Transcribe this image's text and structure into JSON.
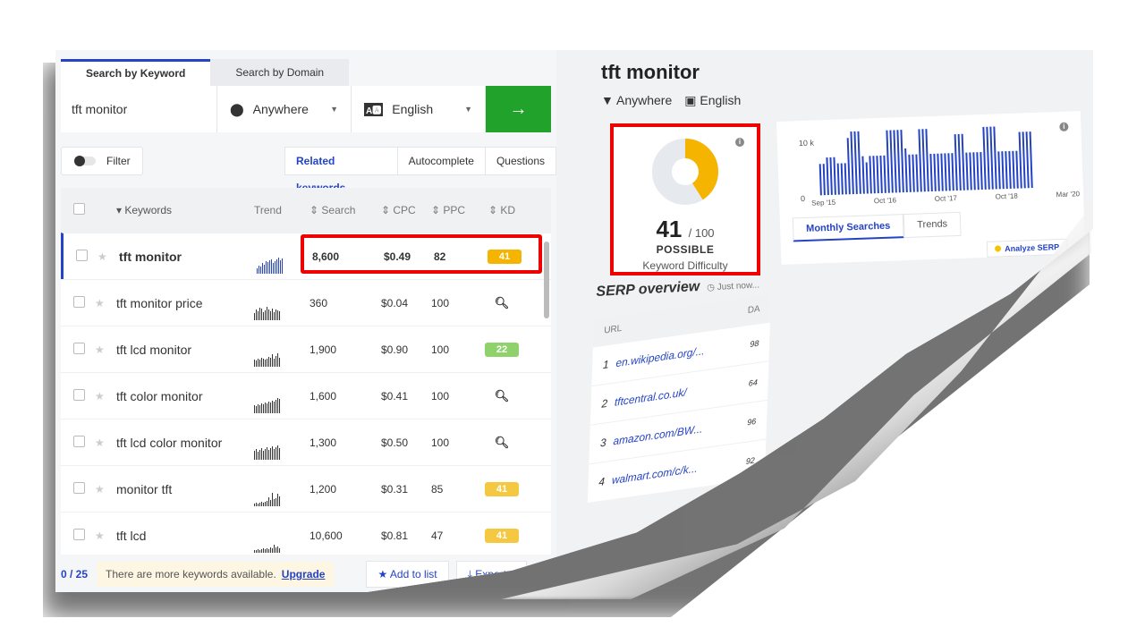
{
  "tabs": [
    "Search by Keyword",
    "Search by Domain"
  ],
  "search": {
    "query": "tft monitor",
    "location": "Anywhere",
    "language": "English",
    "go_icon": "arrow-right-icon"
  },
  "filter_label": "Filter",
  "subtabs": [
    "Related keywords",
    "Autocomplete",
    "Questions"
  ],
  "table": {
    "headers": {
      "keywords": "Keywords",
      "trend": "Trend",
      "search": "Search",
      "cpc": "CPC",
      "ppc": "PPC",
      "kd": "KD"
    },
    "rows": [
      {
        "keyword": "tft monitor",
        "search": "8,600",
        "cpc": "$0.49",
        "ppc": "82",
        "kd": "41",
        "kd_color": "#f5b400",
        "trend": [
          6,
          9,
          8,
          12,
          10,
          14,
          13,
          15,
          16,
          12,
          14,
          16,
          18,
          15,
          17
        ]
      },
      {
        "keyword": "tft monitor price",
        "search": "360",
        "cpc": "$0.04",
        "ppc": "100",
        "kd": "",
        "kd_icon": "search-icon",
        "trend": [
          8,
          12,
          10,
          14,
          13,
          9,
          11,
          15,
          12,
          10,
          13,
          9,
          12,
          11,
          10
        ]
      },
      {
        "keyword": "tft lcd monitor",
        "search": "1,900",
        "cpc": "$0.90",
        "ppc": "100",
        "kd": "22",
        "kd_color": "#8fd16a",
        "trend": [
          8,
          7,
          9,
          8,
          10,
          9,
          8,
          9,
          11,
          10,
          14,
          9,
          12,
          15,
          10
        ]
      },
      {
        "keyword": "tft color monitor",
        "search": "1,600",
        "cpc": "$0.41",
        "ppc": "100",
        "kd": "",
        "kd_icon": "search-icon",
        "trend": [
          9,
          8,
          10,
          9,
          11,
          10,
          12,
          11,
          13,
          12,
          14,
          13,
          15,
          17,
          16
        ]
      },
      {
        "keyword": "tft lcd color monitor",
        "search": "1,300",
        "cpc": "$0.50",
        "ppc": "100",
        "kd": "",
        "kd_icon": "search-icon",
        "trend": [
          10,
          12,
          9,
          11,
          13,
          10,
          12,
          14,
          11,
          13,
          15,
          12,
          14,
          16,
          13
        ]
      },
      {
        "keyword": "monitor tft",
        "search": "1,200",
        "cpc": "$0.31",
        "ppc": "85",
        "kd": "41",
        "kd_color": "#f5c842",
        "trend": [
          3,
          4,
          3,
          4,
          5,
          4,
          5,
          6,
          10,
          7,
          15,
          8,
          9,
          14,
          11
        ]
      },
      {
        "keyword": "tft lcd",
        "search": "10,600",
        "cpc": "$0.81",
        "ppc": "47",
        "kd": "41",
        "kd_color": "#f5c842",
        "trend": [
          3,
          3,
          4,
          3,
          4,
          5,
          4,
          5,
          4,
          6,
          5,
          9,
          6,
          7,
          5
        ]
      }
    ]
  },
  "footer": {
    "count": "0 / 25",
    "notice": "There are more keywords available.",
    "upgrade": "Upgrade",
    "add_to_list": "Add to list",
    "export": "Export"
  },
  "right": {
    "title": "tft monitor",
    "location": "Anywhere",
    "language": "English",
    "kd": {
      "value": "41",
      "max": "/ 100",
      "label": "POSSIBLE",
      "caption": "Keyword Difficulty",
      "fraction": 0.41
    },
    "trend_chart": {
      "y_labels": [
        "10 k",
        "0"
      ],
      "x_labels": [
        "Sep '15",
        "Oct '16",
        "Oct '17",
        "Oct '18",
        "Mar '20"
      ],
      "values": [
        5,
        5,
        6,
        6,
        6,
        5,
        5,
        5,
        9,
        10,
        10,
        10,
        6,
        5,
        6,
        6,
        6,
        6,
        6,
        10,
        10,
        10,
        10,
        10,
        7,
        6,
        6,
        6,
        10,
        10,
        10,
        6,
        6,
        6,
        6,
        6,
        6,
        6,
        9,
        9,
        9,
        6,
        6,
        6,
        6,
        6,
        10,
        10,
        10,
        10,
        6,
        6,
        6,
        6,
        6,
        6,
        9,
        9,
        9,
        9
      ]
    },
    "trend_tabs": [
      "Monthly Searches",
      "Trends"
    ],
    "analyze": "Analyze SERP",
    "serp": {
      "title": "SERP overview",
      "time": "Just now...",
      "headers": {
        "url": "URL",
        "da": "DA"
      },
      "rows": [
        {
          "n": "1",
          "url": "en.wikipedia.org/...",
          "da": "98"
        },
        {
          "n": "2",
          "url": "tftcentral.co.uk/",
          "da": "64"
        },
        {
          "n": "3",
          "url": "amazon.com/BW...",
          "da": "96"
        },
        {
          "n": "4",
          "url": "walmart.com/c/k...",
          "da": "92"
        }
      ]
    }
  }
}
